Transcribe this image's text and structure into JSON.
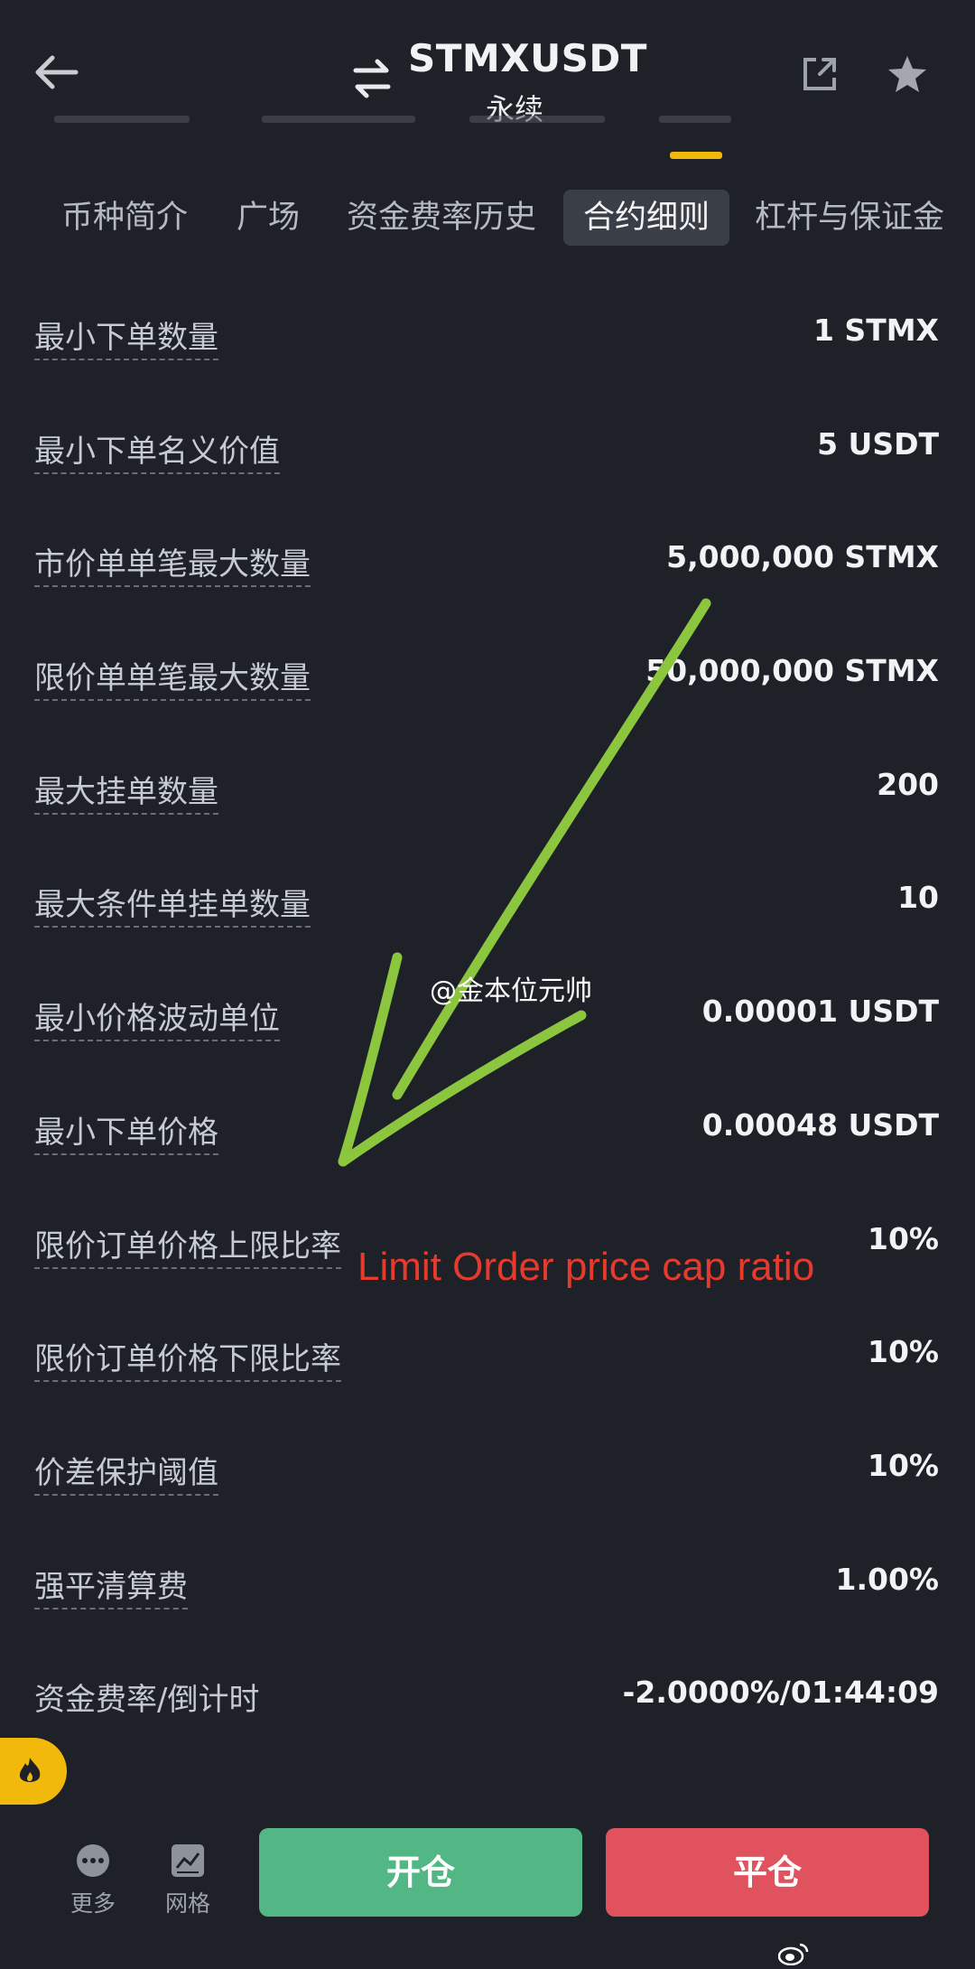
{
  "header": {
    "pair": "STMXUSDT",
    "subtitle": "永续"
  },
  "tabs": [
    {
      "label": "币种简介"
    },
    {
      "label": "广场"
    },
    {
      "label": "资金费率历史"
    },
    {
      "label": "合约细则",
      "active": true
    },
    {
      "label": "杠杆与保证金"
    }
  ],
  "rows": [
    {
      "label": "最小下单数量",
      "value": "1 STMX"
    },
    {
      "label": "最小下单名义价值",
      "value": "5 USDT"
    },
    {
      "label": "市价单单笔最大数量",
      "value": "5,000,000 STMX"
    },
    {
      "label": "限价单单笔最大数量",
      "value": "50,000,000 STMX"
    },
    {
      "label": "最大挂单数量",
      "value": "200"
    },
    {
      "label": "最大条件单挂单数量",
      "value": "10"
    },
    {
      "label": "最小价格波动单位",
      "value": "0.00001 USDT"
    },
    {
      "label": "最小下单价格",
      "value": "0.00048 USDT"
    },
    {
      "label": "限价订单价格上限比率",
      "value": "10%"
    },
    {
      "label": "限价订单价格下限比率",
      "value": "10%"
    },
    {
      "label": "价差保护阈值",
      "value": "10%"
    },
    {
      "label": "强平清算费",
      "value": "1.00%"
    },
    {
      "label": "资金费率/倒计时",
      "value": "-2.0000%/01:44:09"
    }
  ],
  "annotation": {
    "text": "Limit Order price cap ratio",
    "color": "#e43b2c",
    "arrow_color": "#8cc63f"
  },
  "watermark": "@金本位元帅",
  "bottom": {
    "more_label": "更多",
    "grid_label": "网格",
    "open_label": "开仓",
    "close_label": "平仓"
  },
  "colors": {
    "background": "#1f2128",
    "accent": "#f0b90b",
    "buy": "#53b785",
    "sell": "#e0525e"
  }
}
